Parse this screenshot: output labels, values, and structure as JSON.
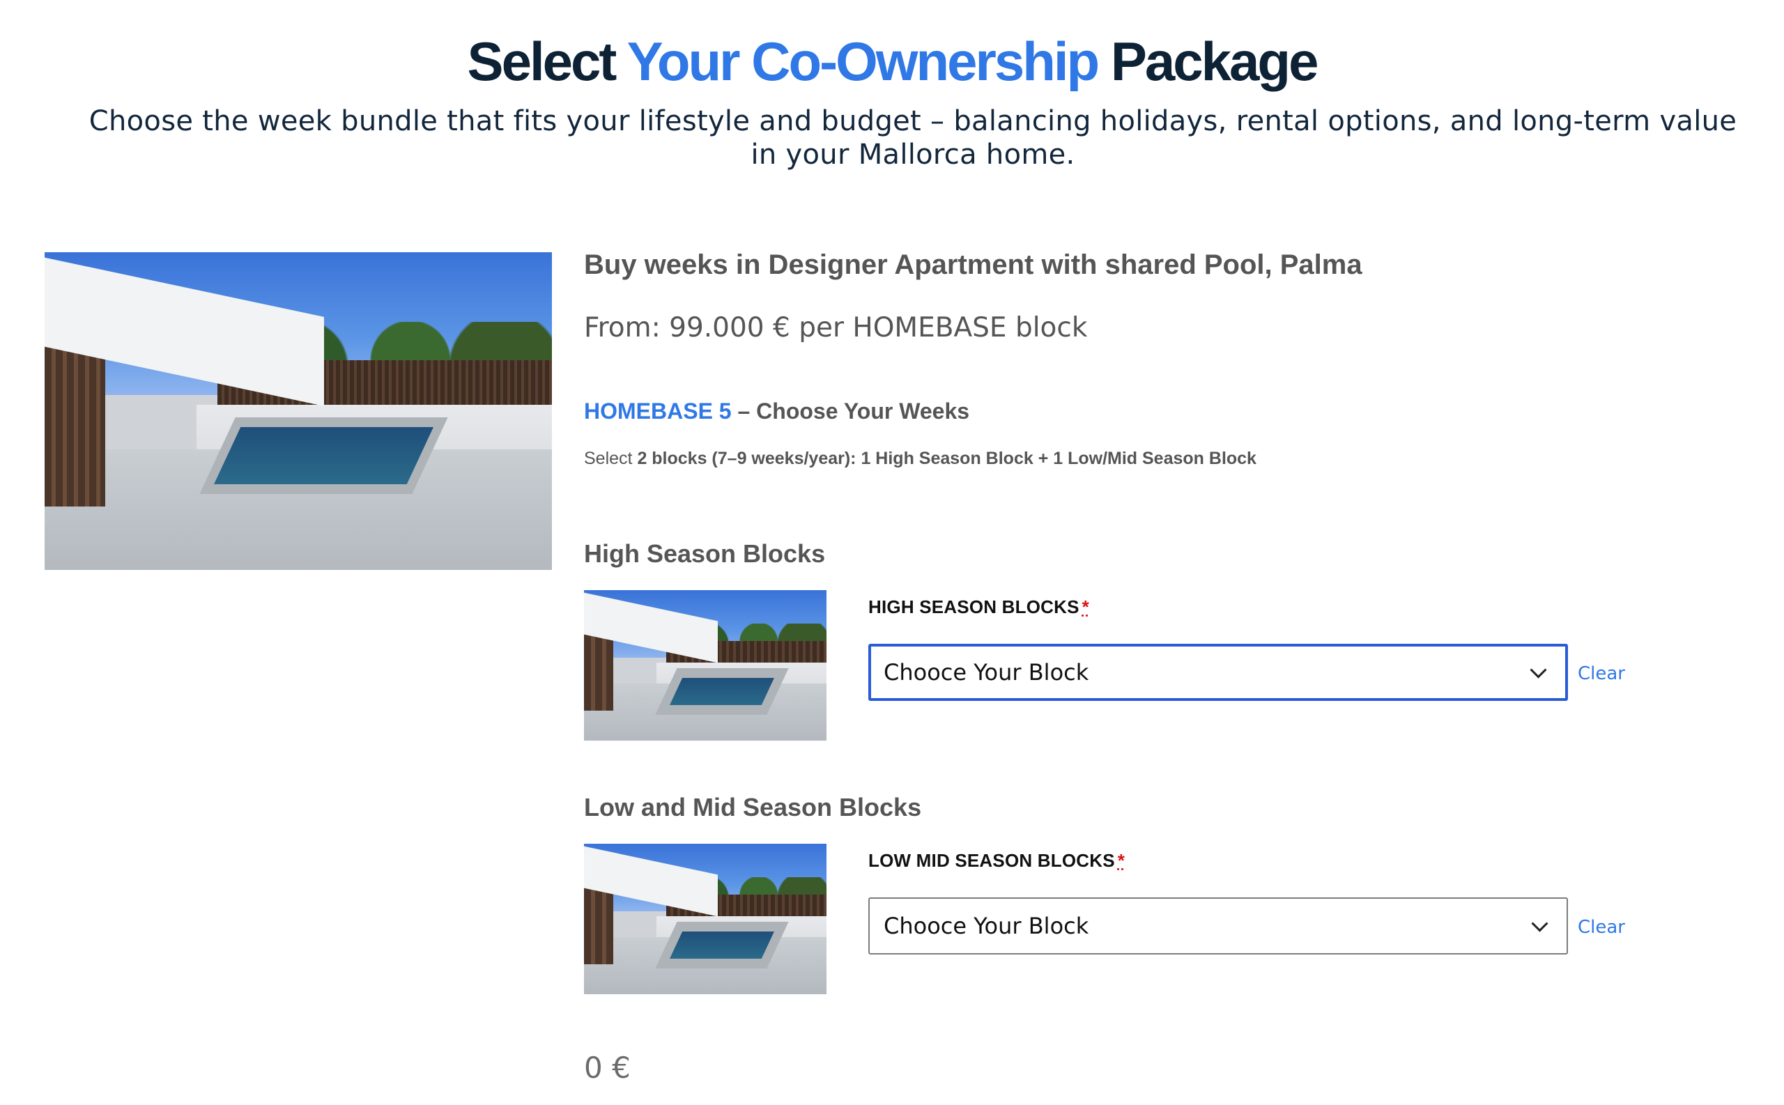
{
  "header": {
    "title_part1": "Select ",
    "title_accent": "Your Co-Ownership",
    "title_part2": " Package",
    "subtitle": "Choose the week bundle that fits your lifestyle and budget – balancing holidays, rental options, and long-term value in your Mallorca home."
  },
  "product": {
    "title": "Buy weeks in Designer Apartment with shared Pool, Palma",
    "price": "From: 99.000 € per HOMEBASE block",
    "bundle_accent": "HOMEBASE 5",
    "bundle_rest": " – Choose Your Weeks",
    "desc_prefix": "Select ",
    "desc_bold": "2 blocks (7–9 weeks/year): 1 High Season Block + 1 Low/Mid Season Block"
  },
  "high_season": {
    "section_title": "High Season Blocks",
    "label": "HIGH SEASON BLOCKS",
    "required_mark": "*",
    "select_value": "Chooce Your Block",
    "clear_label": "Clear"
  },
  "low_mid_season": {
    "section_title": "Low and Mid Season Blocks",
    "label": "LOW MID SEASON BLOCKS",
    "required_mark": "*",
    "select_value": "Chooce Your Block",
    "clear_label": "Clear"
  },
  "total": "0 €",
  "colors": {
    "accent": "#2f78e6",
    "heading": "#0e2236",
    "focus_border": "#2a5bd7",
    "required": "#dd1111"
  },
  "icons": [
    "chevron-down-icon"
  ]
}
